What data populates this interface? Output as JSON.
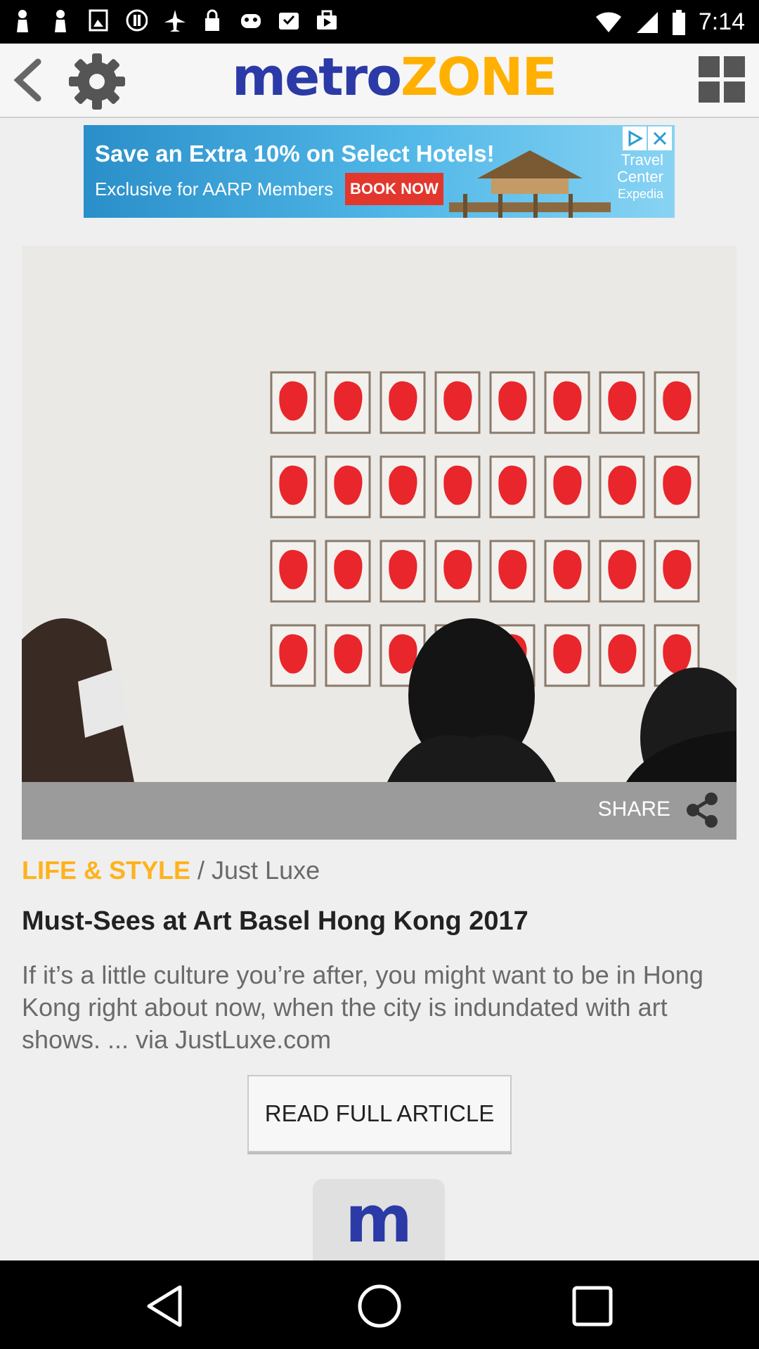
{
  "status_bar": {
    "time": "7:14",
    "icons": [
      "notification-icon",
      "notification-icon",
      "image-icon",
      "alert-icon",
      "airplane-icon",
      "lock-icon",
      "game-icon",
      "inbox-icon",
      "briefcase-icon",
      "wifi-icon",
      "signal-icon",
      "battery-icon"
    ]
  },
  "header": {
    "logo_part1": "metro",
    "logo_part2": "ZONE"
  },
  "ad": {
    "headline": "Save an Extra 10% on Select Hotels!",
    "subline": "Exclusive for AARP Members",
    "cta": "BOOK NOW",
    "brand_line1": "Travel",
    "brand_line2": "Center",
    "brand_line3": "Expedia"
  },
  "article": {
    "share_label": "SHARE",
    "category": "LIFE & STYLE",
    "separator": " / ",
    "source": "Just Luxe",
    "title": "Must-Sees at Art Basel Hong Kong 2017",
    "excerpt": " If it’s a little culture you’re after, you might want to be in Hong Kong right about now, when the city is indundated with art shows.  ...  via JustLuxe.com",
    "read_button": "READ FULL ARTICLE"
  },
  "bottom_tab": {
    "label": "m"
  },
  "colors": {
    "brand_blue": "#2b3aa6",
    "brand_yellow": "#ffb000",
    "category_orange": "#ffb21c"
  }
}
